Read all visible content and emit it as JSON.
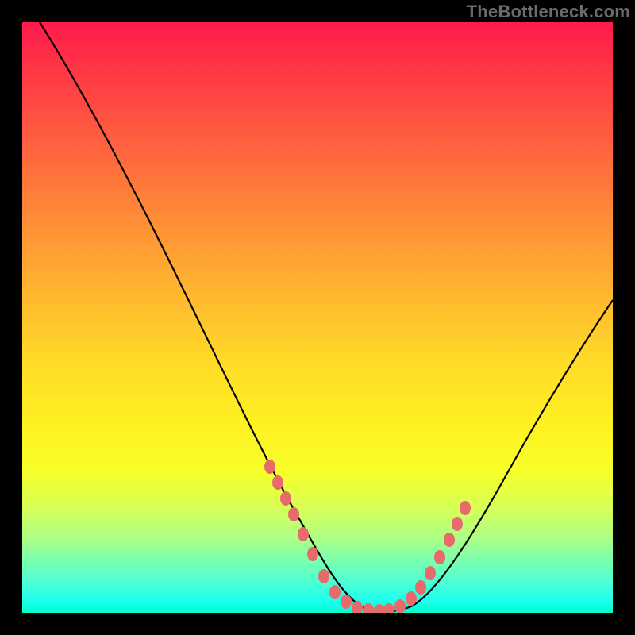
{
  "watermark": "TheBottleneck.com",
  "chart_data": {
    "type": "line",
    "title": "",
    "xlabel": "",
    "ylabel": "",
    "xlim": [
      0,
      100
    ],
    "ylim": [
      0,
      100
    ],
    "grid": false,
    "legend": false,
    "series": [
      {
        "name": "bottleneck-curve",
        "color": "#000000",
        "x": [
          3,
          10,
          18,
          26,
          34,
          40,
          46,
          50,
          54,
          58,
          62,
          66,
          72,
          80,
          90,
          100
        ],
        "y": [
          100,
          90,
          78,
          64,
          48,
          34,
          20,
          10,
          4,
          1,
          1,
          4,
          12,
          26,
          42,
          55
        ]
      }
    ],
    "markers": {
      "name": "highlight-dots",
      "color": "#e76b6b",
      "shape": "rounded-rect",
      "points": [
        {
          "x": 42,
          "y": 28
        },
        {
          "x": 44,
          "y": 23
        },
        {
          "x": 46,
          "y": 18
        },
        {
          "x": 48,
          "y": 13
        },
        {
          "x": 50,
          "y": 8
        },
        {
          "x": 52,
          "y": 5
        },
        {
          "x": 54,
          "y": 3
        },
        {
          "x": 56,
          "y": 1.5
        },
        {
          "x": 58,
          "y": 1
        },
        {
          "x": 60,
          "y": 1
        },
        {
          "x": 62,
          "y": 1.5
        },
        {
          "x": 64,
          "y": 3
        },
        {
          "x": 66,
          "y": 6
        },
        {
          "x": 68,
          "y": 10
        },
        {
          "x": 70,
          "y": 14
        },
        {
          "x": 72,
          "y": 18
        },
        {
          "x": 74,
          "y": 22
        }
      ]
    }
  }
}
